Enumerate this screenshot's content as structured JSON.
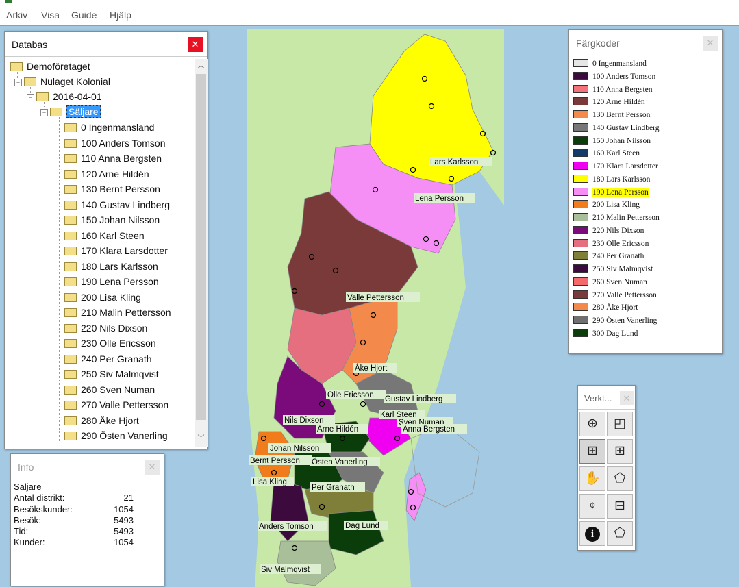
{
  "menu": [
    "Arkiv",
    "Visa",
    "Guide",
    "Hjälp"
  ],
  "database_window": {
    "title": "Databas",
    "tree": {
      "root": "Demoföretaget",
      "company": "Nulaget Kolonial",
      "date": "2016-04-01",
      "group": "Säljare",
      "items": [
        "0 Ingenmansland",
        "100 Anders Tomson",
        "110 Anna Bergsten",
        "120 Arne Hildén",
        "130 Bernt Persson",
        "140 Gustav Lindberg",
        "150 Johan Nilsson",
        "160 Karl Steen",
        "170 Klara Larsdotter",
        "180 Lars Karlsson",
        "190 Lena Persson",
        "200 Lisa Kling",
        "210 Malin Pettersson",
        "220 Nils Dixson",
        "230 Olle Ericsson",
        "240 Per Granath",
        "250 Siv Malmqvist",
        "260 Sven Numan",
        "270 Valle Pettersson",
        "280 Åke Hjort",
        "290 Östen Vanerling"
      ]
    }
  },
  "info_window": {
    "title": "Info",
    "heading": "Säljare",
    "rows": [
      {
        "label": "Antal distrikt:",
        "value": "21"
      },
      {
        "label": "Besökskunder:",
        "value": "1054"
      },
      {
        "label": "Besök:",
        "value": "5493"
      },
      {
        "label": "Tid:",
        "value": "5493"
      },
      {
        "label": "Kunder:",
        "value": "1054"
      }
    ]
  },
  "legend_window": {
    "title": "Färgkoder",
    "highlighted": "190 Lena Persson",
    "entries": [
      {
        "label": "0 Ingenmansland",
        "color": "#e6e6e6"
      },
      {
        "label": "100 Anders Tomson",
        "color": "#3d0a3d"
      },
      {
        "label": "110 Anna Bergsten",
        "color": "#f4737a"
      },
      {
        "label": "120 Arne Hildén",
        "color": "#7b3a3a"
      },
      {
        "label": "130 Bernt Persson",
        "color": "#f38a4b"
      },
      {
        "label": "140 Gustav Lindberg",
        "color": "#777777"
      },
      {
        "label": "150 Johan Nilsson",
        "color": "#0b3d0b"
      },
      {
        "label": "160 Karl Steen",
        "color": "#123a6b"
      },
      {
        "label": "170 Klara Larsdotter",
        "color": "#f000f0"
      },
      {
        "label": "180 Lars Karlsson",
        "color": "#ffff00"
      },
      {
        "label": "190 Lena Persson",
        "color": "#f58ef5"
      },
      {
        "label": "200 Lisa Kling",
        "color": "#f07c1c"
      },
      {
        "label": "210 Malin Pettersson",
        "color": "#a9bf99"
      },
      {
        "label": "220 Nils Dixson",
        "color": "#7b0a7b"
      },
      {
        "label": "230 Olle Ericsson",
        "color": "#e66f7f"
      },
      {
        "label": "240 Per Granath",
        "color": "#7f7f3a"
      },
      {
        "label": "250 Siv Malmqvist",
        "color": "#3d0a3d"
      },
      {
        "label": "260 Sven Numan",
        "color": "#f46a6a"
      },
      {
        "label": "270 Valle Pettersson",
        "color": "#7b3a3a"
      },
      {
        "label": "280 Åke Hjort",
        "color": "#f38a4b"
      },
      {
        "label": "290 Östen Vanerling",
        "color": "#6f6f6f"
      },
      {
        "label": "300 Dag Lund",
        "color": "#0b3d0b"
      }
    ]
  },
  "toolbox_window": {
    "title": "Verkt...",
    "tools": [
      "zoom-in-icon",
      "select-area-icon",
      "zoom-box-icon",
      "grid-icon",
      "pan-hand-icon",
      "polygon-icon",
      "center-target-icon",
      "area-info-icon",
      "info-icon",
      "polygon-info-icon"
    ]
  },
  "map_labels": [
    "Lars Karlsson",
    "Lena Persson",
    "Valle Pettersson",
    "Åke Hjort",
    "Olle Ericsson",
    "Gustav Lindberg",
    "Karl Steen",
    "Sven Numan",
    "Anna Bergsten",
    "Nils Dixson",
    "Arne Hildén",
    "Johan Nilsson",
    "Östen Vanerling",
    "Bernt Persson",
    "Lisa Kling",
    "Per Granath",
    "Anders Tomson",
    "Dag Lund",
    "Siv Malmqvist"
  ]
}
